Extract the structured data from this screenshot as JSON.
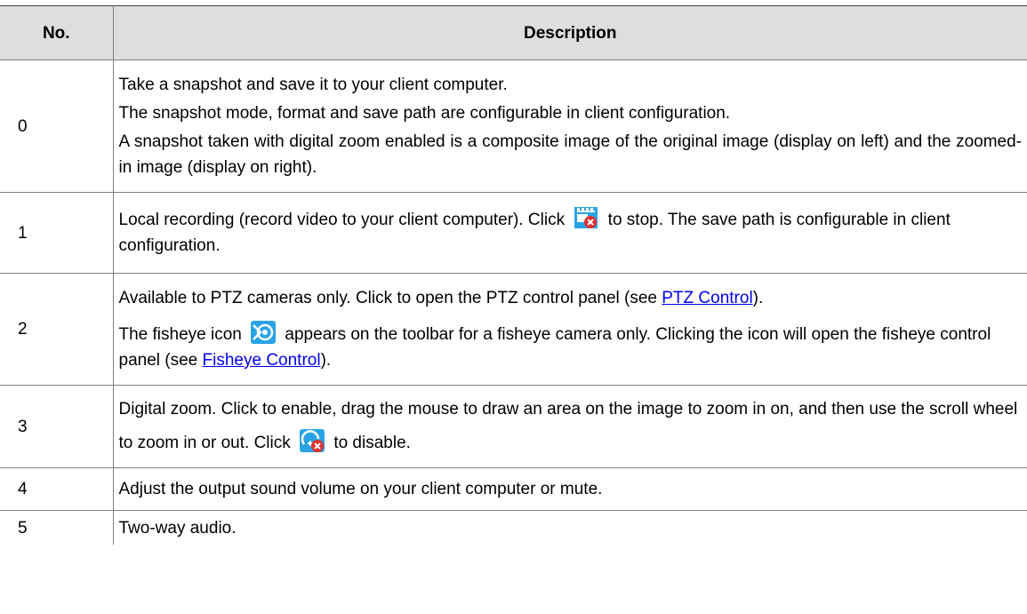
{
  "table": {
    "headers": {
      "no": "No.",
      "description": "Description"
    },
    "rows": [
      {
        "no": "0",
        "lines": [
          "Take a snapshot and save it to your client computer.",
          "The snapshot mode, format and save path are configurable in client configuration.",
          "A snapshot taken with digital zoom enabled is a composite image of the original image (display on left) and the zoomed-in image (display on right)."
        ]
      },
      {
        "no": "1",
        "text_before_icon": "Local recording (record video to your client computer). Click",
        "icon": "stop-recording-icon",
        "text_after_icon": "to stop. The save path is configurable in client configuration."
      },
      {
        "no": "2",
        "line1_before_link": "Available to PTZ cameras only. Click to open the PTZ control panel (see ",
        "line1_link": "PTZ Control",
        "line1_after_link": ").",
        "line2_before_icon": "The fisheye icon",
        "line2_icon": "fisheye-icon",
        "line2_after_icon": "appears on the toolbar for a fisheye camera only. Clicking the icon will open the fisheye control panel (see ",
        "line2_link": "Fisheye Control",
        "line2_after_link": ")."
      },
      {
        "no": "3",
        "text_before_icon": "Digital zoom. Click to enable, drag the mouse to draw an area on the image to zoom in on, and then use the scroll wheel to zoom in or out. Click",
        "icon": "disable-digital-zoom-icon",
        "text_after_icon": "to disable."
      },
      {
        "no": "4",
        "text": "Adjust the output sound volume on your client computer or mute."
      },
      {
        "no": "5",
        "text": "Two-way audio."
      }
    ]
  },
  "colors": {
    "header_bg": "#dedede",
    "border": "#808080",
    "link": "#0000ee",
    "icon_blue": "#29a3e6",
    "icon_red": "#e03030"
  }
}
